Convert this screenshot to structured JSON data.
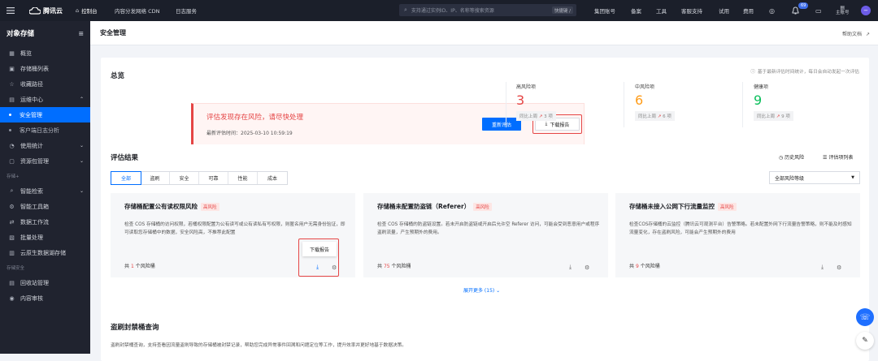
{
  "topbar": {
    "logo": "腾讯云",
    "console": "控制台",
    "nav": [
      "内容分发网络 CDN",
      "日志服务"
    ],
    "search_placeholder": "支持通过实例ID、IP、名称等搜索资源",
    "shortcut": "快捷键 /",
    "links": [
      "集团账号",
      "备案",
      "工具",
      "客服支持",
      "试用",
      "费用"
    ],
    "notification_count": "69",
    "account": "主账号"
  },
  "sidebar": {
    "title": "对象存储",
    "items": [
      {
        "label": "概览",
        "icon": "grid-icon"
      },
      {
        "label": "存储桶列表",
        "icon": "bucket-icon"
      },
      {
        "label": "收藏路径",
        "icon": "star-icon"
      },
      {
        "label": "运维中心",
        "icon": "ops-icon"
      },
      {
        "label": "安全管理",
        "icon": "dot"
      },
      {
        "label": "客户端日志分析",
        "icon": "dot"
      },
      {
        "label": "使用统计",
        "icon": "chart-icon"
      },
      {
        "label": "资源包管理",
        "icon": "package-icon"
      }
    ],
    "group1": "存储+",
    "items2": [
      {
        "label": "智能检索",
        "icon": "search-icon"
      },
      {
        "label": "智能工具箱",
        "icon": "toolbox-icon"
      },
      {
        "label": "数据工作流",
        "icon": "workflow-icon"
      },
      {
        "label": "批量处理",
        "icon": "batch-icon"
      },
      {
        "label": "云原生数据湖存储",
        "icon": "lake-icon"
      }
    ],
    "group2": "存储安全",
    "items3": [
      {
        "label": "回收站管理",
        "icon": "trash-icon"
      },
      {
        "label": "内容审核",
        "icon": "audit-icon"
      }
    ]
  },
  "page": {
    "title": "安全管理",
    "help": "帮助文档"
  },
  "overview": {
    "title": "总览",
    "note": "基于最新评估时间统计，每日会自动发起一次评估",
    "alert_title": "评估发现存在风险，请尽快处理",
    "alert_time_label": "最新评估时间：",
    "alert_time": "2025-03-10 10:59:19",
    "reassess": "重新评估",
    "download": "下载报告",
    "stats": [
      {
        "label": "高风险项",
        "value": "3",
        "cmp": "同比上周",
        "delta": "3 项",
        "color": "#e54545"
      },
      {
        "label": "中风险项",
        "value": "6",
        "cmp": "同比上周",
        "delta": "6 项",
        "color": "#ff9c19"
      },
      {
        "label": "健康项",
        "value": "9",
        "cmp": "同比上周",
        "delta": "9 项",
        "color": "#0abf5b"
      }
    ]
  },
  "results": {
    "title": "评估结果",
    "history": "历史风险",
    "list": "评估项列表",
    "tabs": [
      "全部",
      "盗刷",
      "安全",
      "可靠",
      "性能",
      "成本"
    ],
    "level_select": "全部风险等级",
    "cards": [
      {
        "title": "存储桶配置公有读权限风险",
        "badge": "高风险",
        "desc": "检查 COS 存储桶的访问权限，若桶权限配置为公有读写或公有读私有写权限，则匿名用户无需身份验证，即可读取您存储桶中的数据，安全风险高，不推荐此配置",
        "prefix": "共",
        "count": "1",
        "suffix": "个风险桶"
      },
      {
        "title": "存储桶未配置防盗链（Referer）",
        "badge": "高风险",
        "desc": "检查 COS 存储桶的防盗链设置。若未开启防盗链或开启后允许空 Referer 访问，可能会受到恶意用户或程序盗刷流量，产生预期外的费用。",
        "prefix": "共",
        "count": "75",
        "suffix": "个风险桶"
      },
      {
        "title": "存储桶未接入公网下行流量监控",
        "badge": "高风险",
        "desc": "检查COS存储桶的云监控（腾讯云可观测平台）告警策略。若未配置外网下行流量告警策略，则不能及时感知流量变化，存在盗刷风险，可能会产生预期外的费用",
        "prefix": "共",
        "count": "9",
        "suffix": "个风险桶"
      }
    ],
    "tooltip": "下载报告",
    "expand": "展开更多 (15)"
  },
  "blocked": {
    "title": "盗刷封禁桶查询",
    "desc": "盗刷封禁桶查询，支持查看因流量盗刷导致的存储桶被封禁记录，帮助您完成异常事件回溯和问题定位等工作，提升效率并更好地基于数据决策。"
  }
}
